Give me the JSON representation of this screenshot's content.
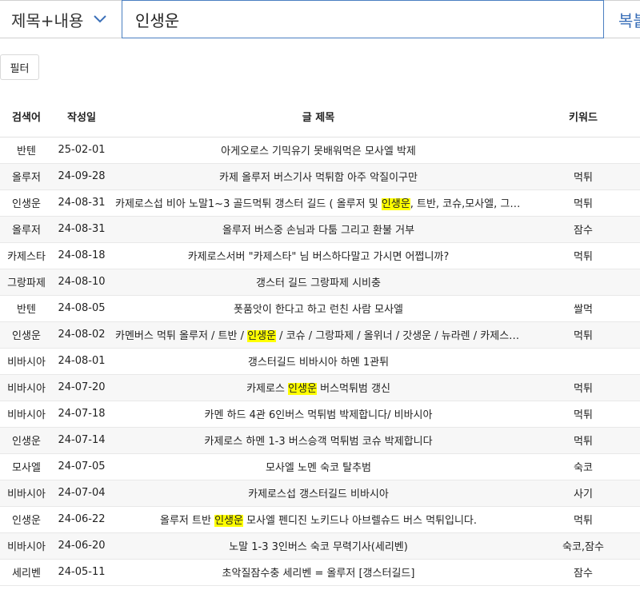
{
  "search": {
    "scope_label": "제목+내용",
    "query": "인생운",
    "copy_label": "복붙"
  },
  "filter_label": "필터",
  "table": {
    "headers": {
      "term": "검색어",
      "date": "작성일",
      "title": "글 제목",
      "keyword": "키워드"
    },
    "highlight_color": "#ffff00",
    "rows": [
      {
        "term": "반텐",
        "date": "25-02-01",
        "title": [
          {
            "t": "아게오로스 기믹유기 못배워먹은 모사엘 박제"
          }
        ],
        "keyword": ""
      },
      {
        "term": "올루저",
        "date": "24-09-28",
        "title": [
          {
            "t": "카제 올루저 버스기사 먹튀함 아주 악질이구만"
          }
        ],
        "keyword": "먹튀"
      },
      {
        "term": "인생운",
        "date": "24-08-31",
        "title": [
          {
            "t": "카제로스섭 비아 노말1~3 골드먹튀 갱스터 길드 ( 올루저 및 "
          },
          {
            "t": "인생운",
            "hl": true
          },
          {
            "t": ", 트반, 코슈,모사엘, 그랑파제, 시비충 )"
          }
        ],
        "keyword": "먹튀"
      },
      {
        "term": "올루저",
        "date": "24-08-31",
        "title": [
          {
            "t": "올루저 버스중 손님과 다툼 그리고 환불 거부"
          }
        ],
        "keyword": "잠수"
      },
      {
        "term": "카제스타",
        "date": "24-08-18",
        "title": [
          {
            "t": "카제로스서버 \"카제스타\" 님 버스하다말고 가시면 어쩝니까?"
          }
        ],
        "keyword": "먹튀"
      },
      {
        "term": "그랑파제",
        "date": "24-08-10",
        "title": [
          {
            "t": "갱스터 길드 그랑파제 시비충"
          }
        ],
        "keyword": ""
      },
      {
        "term": "반텐",
        "date": "24-08-05",
        "title": [
          {
            "t": "폿품앗이 한다고 하고 런친 사람 모사엘"
          }
        ],
        "keyword": "쌀먹"
      },
      {
        "term": "인생운",
        "date": "24-08-02",
        "title": [
          {
            "t": "카멘버스 먹튀 올루저 / 트반 / "
          },
          {
            "t": "인생운",
            "hl": true
          },
          {
            "t": " / 코슈 / 그랑파제 / 올위너 / 갓생운 / 뉴라렌 / 카제스타 / 모사엘"
          }
        ],
        "keyword": "먹튀"
      },
      {
        "term": "비바시아",
        "date": "24-08-01",
        "title": [
          {
            "t": "갱스터길드 비바시아 하멘 1관튀"
          }
        ],
        "keyword": ""
      },
      {
        "term": "비바시아",
        "date": "24-07-20",
        "title": [
          {
            "t": "카제로스 "
          },
          {
            "t": "인생운",
            "hl": true
          },
          {
            "t": " 버스먹튀범 갱신"
          }
        ],
        "keyword": "먹튀"
      },
      {
        "term": "비바시아",
        "date": "24-07-18",
        "title": [
          {
            "t": "카멘 하드 4관 6인버스 먹튀범 박제합니다/ 비바시아"
          }
        ],
        "keyword": "먹튀"
      },
      {
        "term": "인생운",
        "date": "24-07-14",
        "title": [
          {
            "t": "카제로스 하멘 1-3 버스승객 먹튀범 코슈 박제합니다"
          }
        ],
        "keyword": "먹튀"
      },
      {
        "term": "모사엘",
        "date": "24-07-05",
        "title": [
          {
            "t": "모사엘 노멘 숙코 탈추범"
          }
        ],
        "keyword": "숙코"
      },
      {
        "term": "비바시아",
        "date": "24-07-04",
        "title": [
          {
            "t": "카제로스섭 갱스터길드 비바시아"
          }
        ],
        "keyword": "사기"
      },
      {
        "term": "인생운",
        "date": "24-06-22",
        "title": [
          {
            "t": "올루저 트반 "
          },
          {
            "t": "인생운",
            "hl": true
          },
          {
            "t": " 모사엘 펜디진 노키드나 아브렐슈드 버스 먹튀입니다."
          }
        ],
        "keyword": "먹튀"
      },
      {
        "term": "비바시아",
        "date": "24-06-20",
        "title": [
          {
            "t": "노말 1-3 3인버스 숙코 무력기사(세리벤)"
          }
        ],
        "keyword": "숙코,잠수"
      },
      {
        "term": "세리벤",
        "date": "24-05-11",
        "title": [
          {
            "t": "초악질잠수충 세리벤 = 올루저 [갱스터길드]"
          }
        ],
        "keyword": "잠수"
      }
    ]
  }
}
